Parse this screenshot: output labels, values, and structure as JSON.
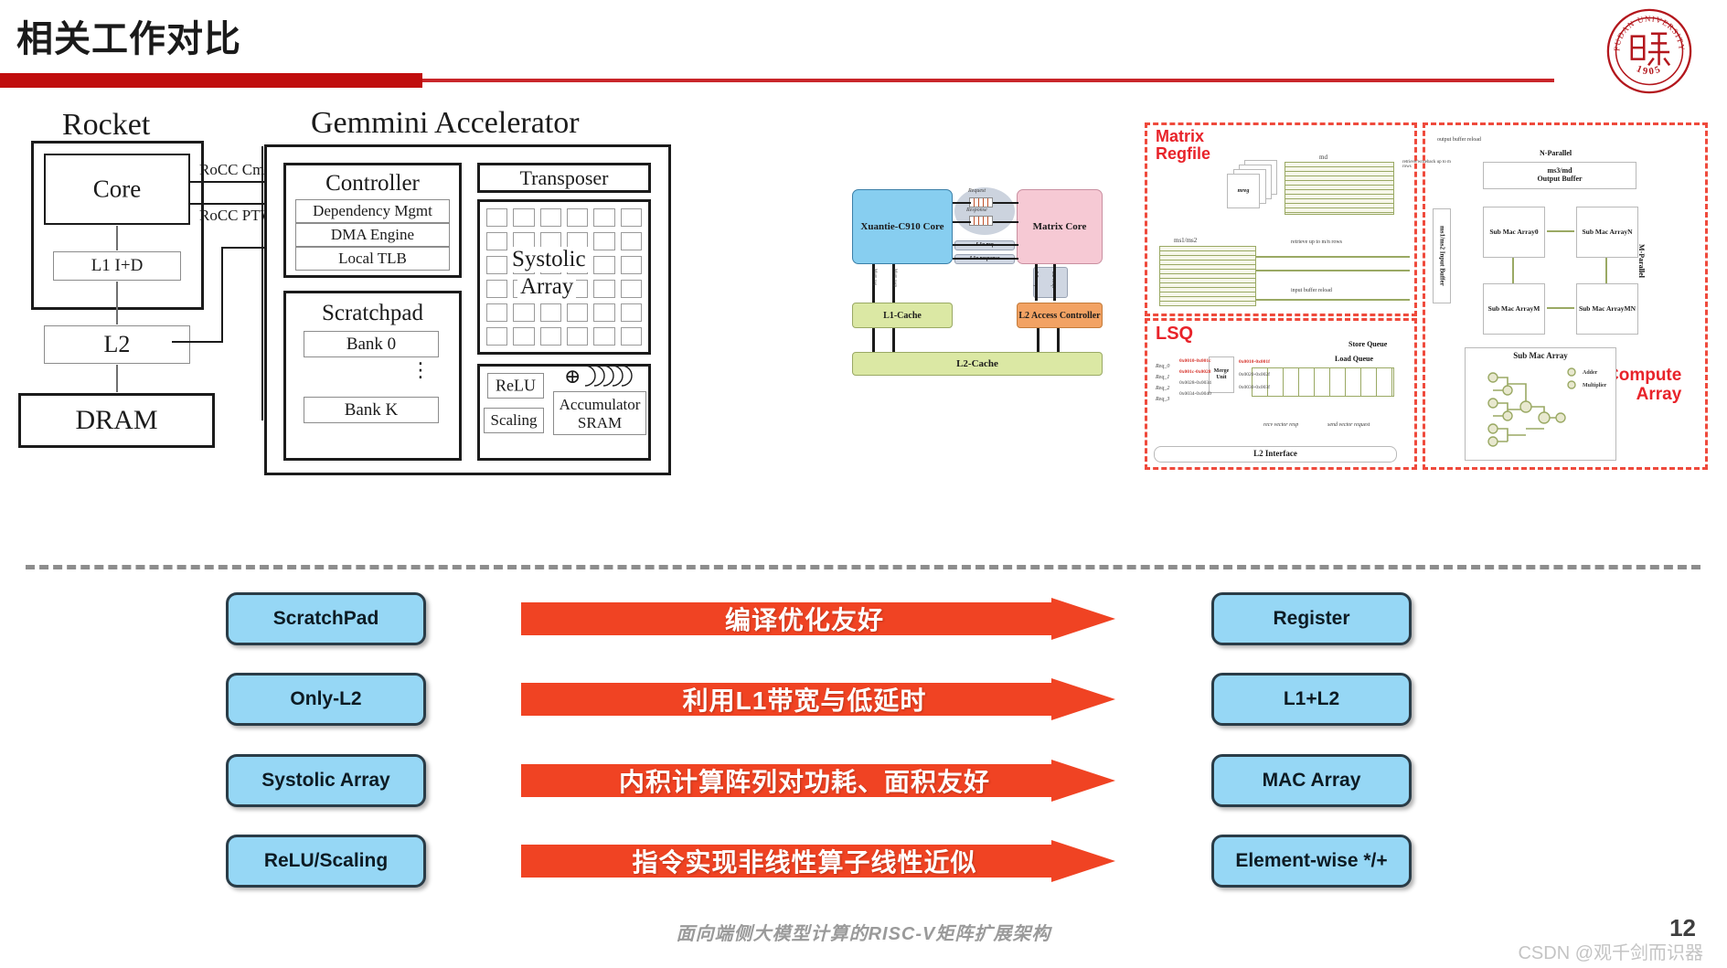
{
  "slide": {
    "title": "相关工作对比",
    "page_number": "12",
    "footer_note": "面向端侧大模型计算的RISC-V矩阵扩展架构",
    "watermark": "CSDN @观千剑而识器",
    "accent_red": "#c00d0d",
    "arrow_red": "#f04323",
    "pill_blue": "#96d7f5"
  },
  "logo": {
    "name": "fudan-university-seal",
    "outer_text": "FUDAN UNIVERSITY",
    "year": "1905",
    "color": "#b3161c"
  },
  "left_diagram": {
    "rocket_title": "Rocket",
    "gemmini_title": "Gemmini Accelerator",
    "rocket": {
      "core": "Core",
      "l1": "L1 I+D",
      "l2": "L2",
      "dram": "DRAM"
    },
    "links": {
      "rocc_cmd": "RoCC Cmd",
      "rocc_ptw": "RoCC PTW"
    },
    "controller": {
      "title": "Controller",
      "items": [
        "Dependency Mgmt",
        "DMA Engine",
        "Local TLB"
      ]
    },
    "scratchpad": {
      "title": "Scratchpad",
      "bank_first": "Bank 0",
      "bank_last": "Bank K",
      "ellipsis": "⋮"
    },
    "transposer": "Transposer",
    "systolic": {
      "line1": "Systolic",
      "line2": "Array",
      "rows": 6,
      "cols": 6
    },
    "postproc": {
      "relu": "ReLU",
      "scaling": "Scaling",
      "accumulator": "Accumulator",
      "sram": "SRAM",
      "adder_glyph": "⊕"
    }
  },
  "right_diagram": {
    "core_block": {
      "xuantie": "Xuantie-C910 Core",
      "matrix_core": "Matrix Core",
      "l1_cache": "L1-Cache",
      "l2_cache": "L2-Cache",
      "l2_access_controller": "L2 Access Controller",
      "request": "Request",
      "response": "Response",
      "l1_req": "L1o.req",
      "l1_resp": "L1o.response",
      "l2_req": "L2 req",
      "l2_resp": "L2 resp",
      "mem_req": "Mem req",
      "mem_resp": "Mem resp"
    },
    "matrix_regfile": {
      "label": "Matrix\nRegfile",
      "label_line1": "Matrix",
      "label_line2": "Regfile",
      "mreg": "mreg",
      "md": "md",
      "ms": "ms1/ms2",
      "note_writeback": "retrieve/writeback up to m rows",
      "note_retrieve": "retrieve up to m/n rows",
      "note_release": "input buffer reload"
    },
    "lsq": {
      "label": "LSQ",
      "merge_unit": "Merge Unit",
      "store_queue": "Store Queue",
      "load_queue": "Load Queue",
      "l2_interface": "L2 Interface",
      "requests": [
        "Req_0",
        "Req_1",
        "Req_2",
        "Req_3"
      ],
      "addr_ranges": [
        "0x0010-0x001c",
        "0x001c-0x0028",
        "0x0028-0x0034",
        "0x0034-0x0040"
      ],
      "merged_ranges": [
        "0x0010-0x001f",
        "0x0020-0x002f",
        "0x0030-0x003f"
      ],
      "recv_vector": "recv vector resp",
      "send_vector": "send vector request"
    },
    "compute_array": {
      "label_line1": "Compute",
      "label_line2": "Array",
      "output_buffer_line1": "ms3/md",
      "output_buffer_line2": "Output Buffer",
      "input_buffer": "ms1/ms2 Input Buffer",
      "n_parallel": "N-Parallel",
      "m_parallel": "M-Parallel",
      "output_reload": "output buffer reload",
      "sub_arrays": [
        "Sub Mac Array0",
        "Sub Mac ArrayN",
        "Sub Mac ArrayM",
        "Sub Mac ArrayMN"
      ],
      "detail_title": "Sub Mac Array",
      "legend_adder": "Adder",
      "legend_multiplier": "Multiplier"
    }
  },
  "comparison": {
    "left_items": [
      "ScratchPad",
      "Only-L2",
      "Systolic Array",
      "ReLU/Scaling"
    ],
    "arrows": [
      "编译优化友好",
      "利用L1带宽与低延时",
      "内积计算阵列对功耗、面积友好",
      "指令实现非线性算子线性近似"
    ],
    "right_items": [
      "Register",
      "L1+L2",
      "MAC Array",
      "Element-wise */+"
    ]
  }
}
